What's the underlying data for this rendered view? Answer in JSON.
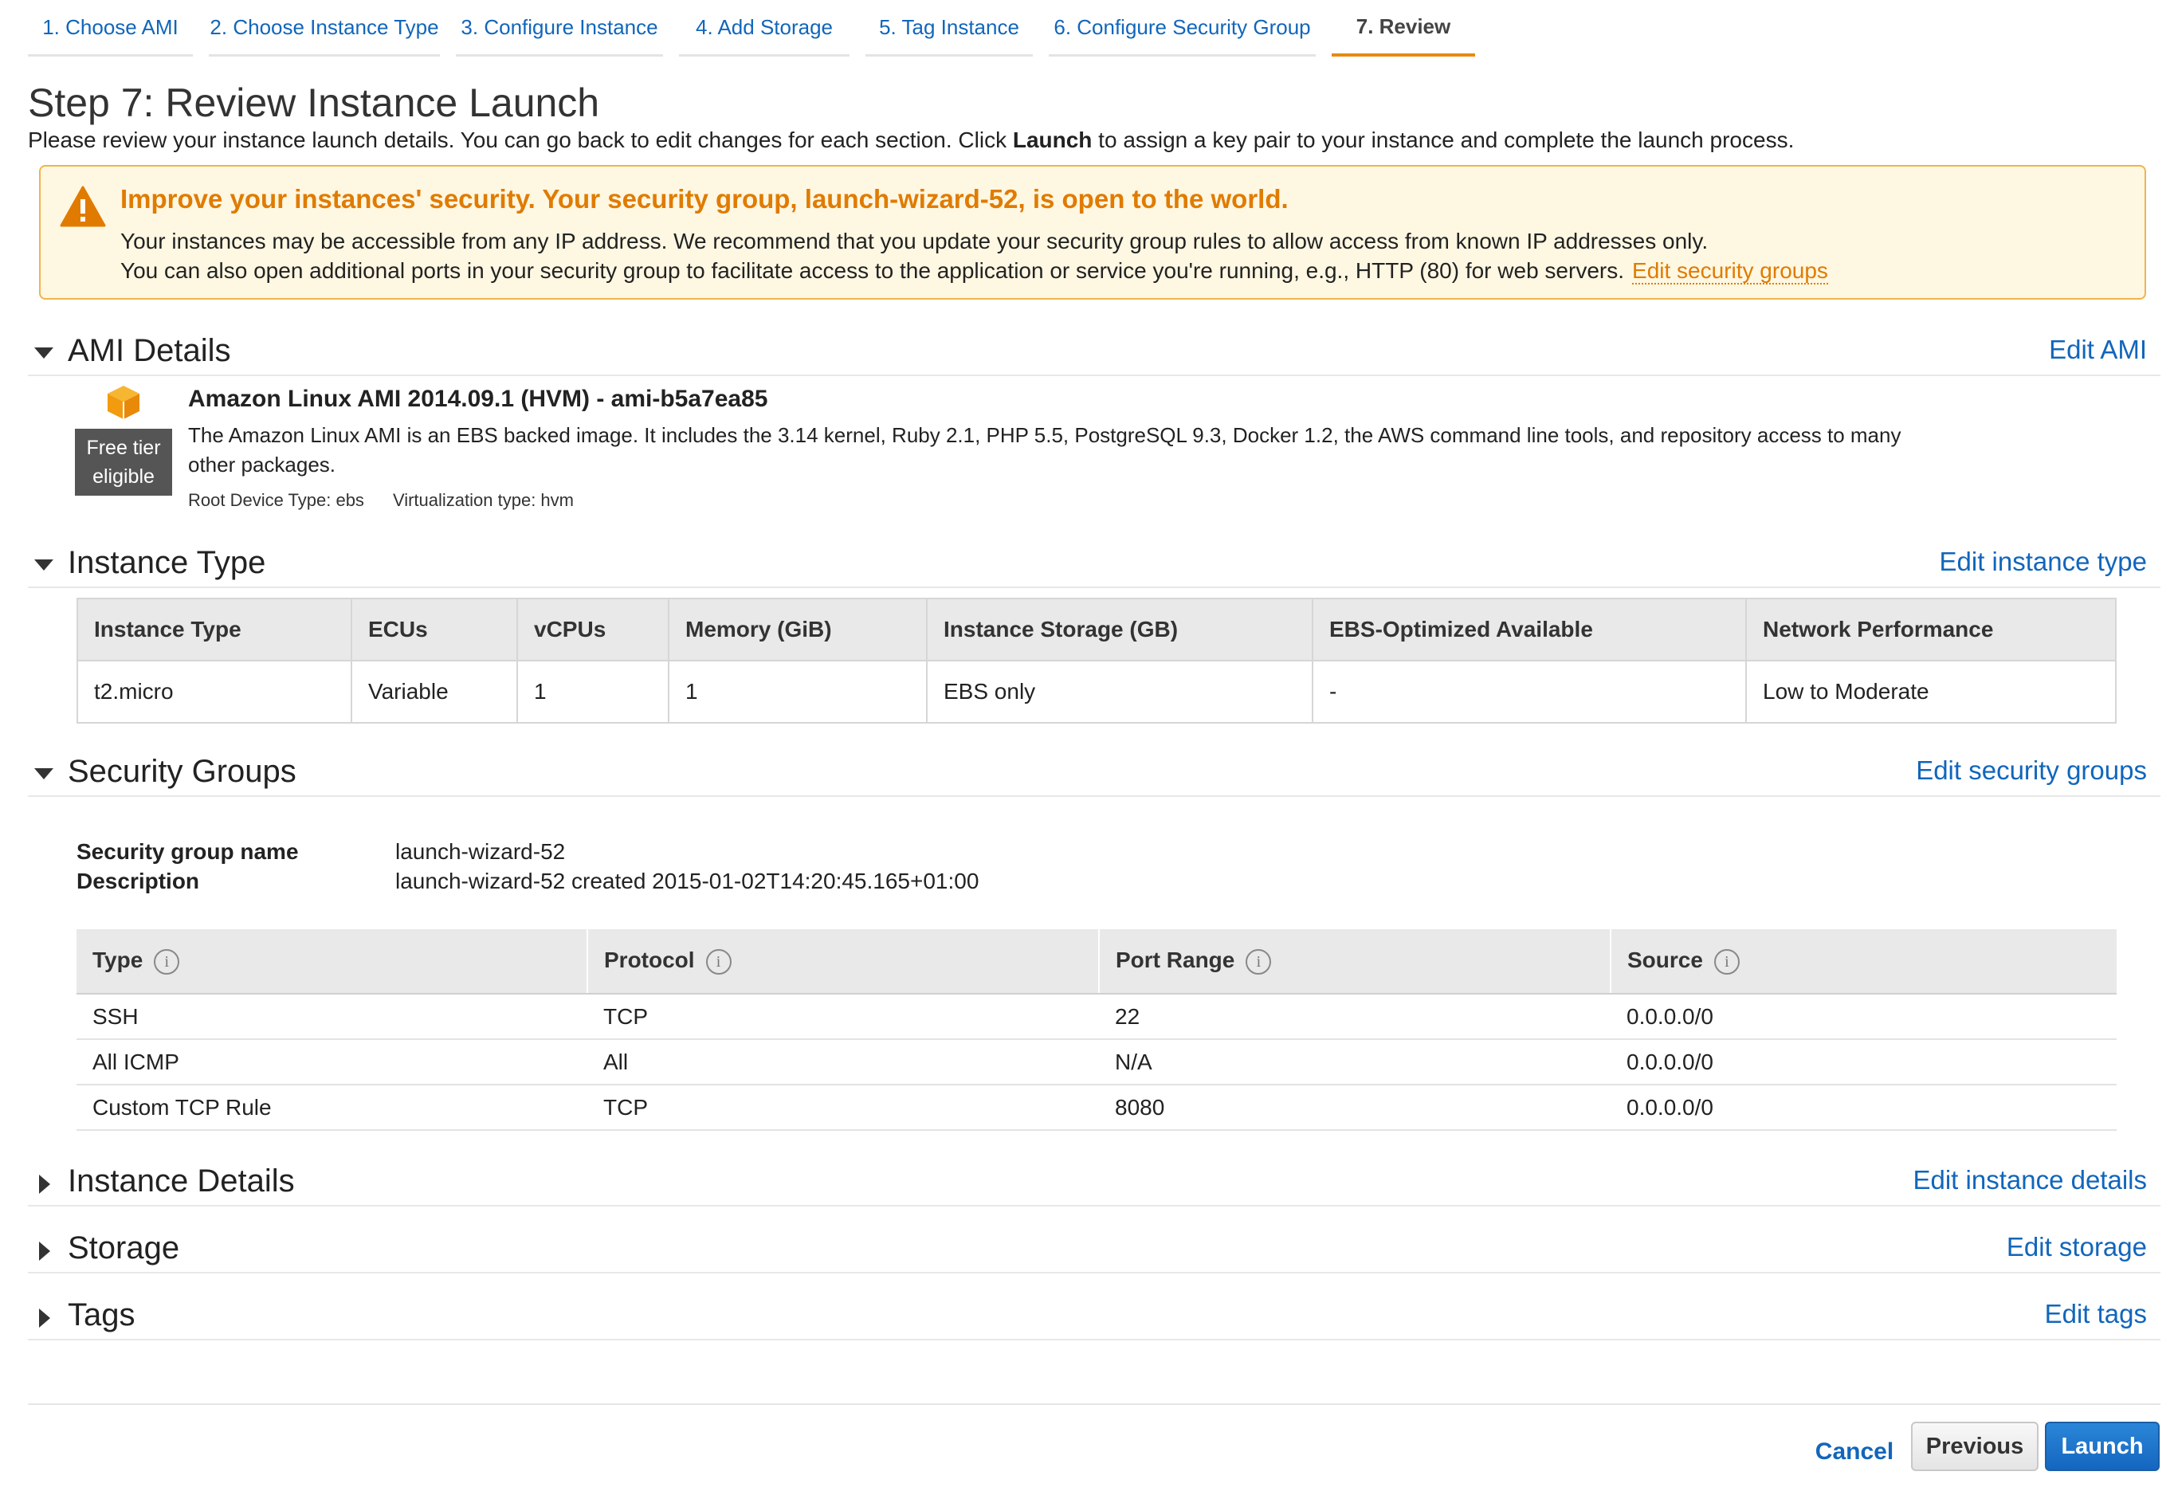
{
  "wizard": {
    "steps": [
      {
        "label": "1. Choose AMI"
      },
      {
        "label": "2. Choose Instance Type"
      },
      {
        "label": "3. Configure Instance"
      },
      {
        "label": "4. Add Storage"
      },
      {
        "label": "5. Tag Instance"
      },
      {
        "label": "6. Configure Security Group"
      },
      {
        "label": "7. Review"
      }
    ],
    "active_step": "7. Review"
  },
  "page": {
    "title": "Step 7: Review Instance Launch",
    "intro_before": "Please review your instance launch details. You can go back to edit changes for each section. Click ",
    "intro_bold": "Launch",
    "intro_after": " to assign a key pair to your instance and complete the launch process."
  },
  "warning": {
    "icon": "warning-triangle-icon",
    "title": "Improve your instances' security. Your security group, launch-wizard-52, is open to the world.",
    "line1": "Your instances may be accessible from any IP address. We recommend that you update your security group rules to allow access from known IP addresses only.",
    "line2": "You can also open additional ports in your security group to facilitate access to the application or service you're running, e.g., HTTP (80) for web servers.",
    "link": "Edit security groups"
  },
  "ami_details": {
    "title": "AMI Details",
    "edit": "Edit AMI",
    "icon": "amazon-box-icon",
    "badge_line1": "Free tier",
    "badge_line2": "eligible",
    "name": "Amazon Linux AMI 2014.09.1 (HVM) - ami-b5a7ea85",
    "description": "The Amazon Linux AMI is an EBS backed image. It includes the 3.14 kernel, Ruby 2.1, PHP 5.5, PostgreSQL 9.3, Docker 1.2, the AWS command line tools, and repository access to many other packages.",
    "root_device": "Root Device Type: ebs",
    "virtualization": "Virtualization type: hvm"
  },
  "instance_type": {
    "title": "Instance Type",
    "edit": "Edit instance type",
    "headers": [
      "Instance Type",
      "ECUs",
      "vCPUs",
      "Memory (GiB)",
      "Instance Storage (GB)",
      "EBS-Optimized Available",
      "Network Performance"
    ],
    "row": [
      "t2.micro",
      "Variable",
      "1",
      "1",
      "EBS only",
      "-",
      "Low to Moderate"
    ]
  },
  "security_groups": {
    "title": "Security Groups",
    "edit": "Edit security groups",
    "name_label": "Security group name",
    "name_value": "launch-wizard-52",
    "desc_label": "Description",
    "desc_value": "launch-wizard-52 created 2015-01-02T14:20:45.165+01:00",
    "headers": [
      "Type",
      "Protocol",
      "Port Range",
      "Source"
    ],
    "rows": [
      [
        "SSH",
        "TCP",
        "22",
        "0.0.0.0/0"
      ],
      [
        "All ICMP",
        "All",
        "N/A",
        "0.0.0.0/0"
      ],
      [
        "Custom TCP Rule",
        "TCP",
        "8080",
        "0.0.0.0/0"
      ]
    ]
  },
  "instance_details": {
    "title": "Instance Details",
    "edit": "Edit instance details"
  },
  "storage": {
    "title": "Storage",
    "edit": "Edit storage"
  },
  "tags": {
    "title": "Tags",
    "edit": "Edit tags"
  },
  "footer": {
    "cancel": "Cancel",
    "previous": "Previous",
    "launch": "Launch"
  },
  "colors": {
    "accent_orange": "#e07b00",
    "link_blue": "#1166bb",
    "launch_blue": "#1566bf"
  }
}
